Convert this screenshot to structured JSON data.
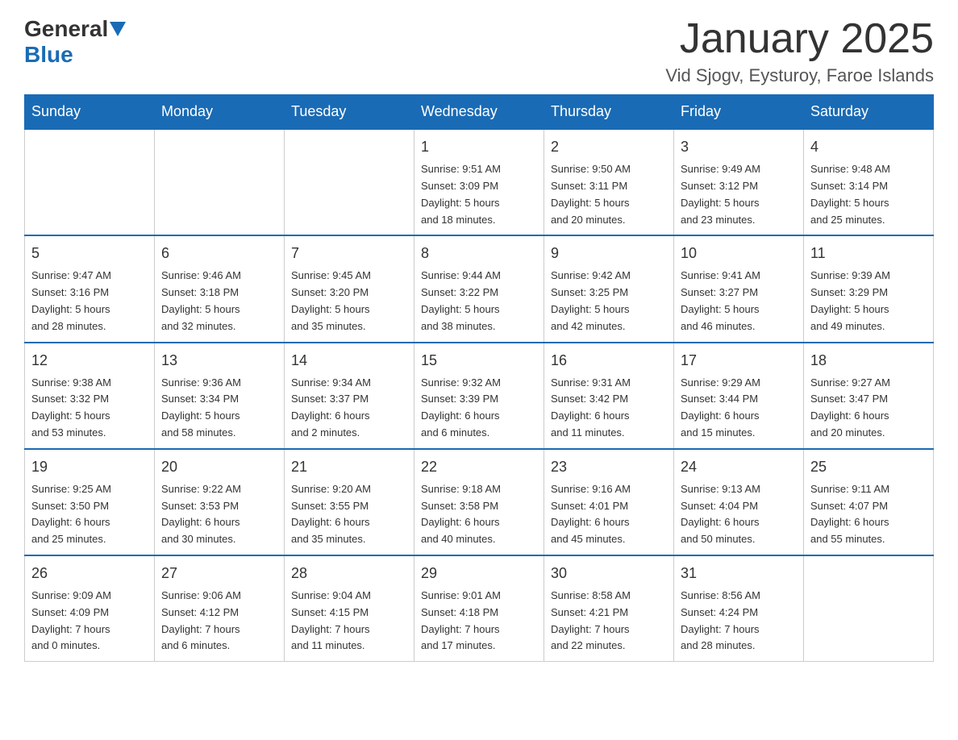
{
  "header": {
    "logo": {
      "general": "General",
      "blue": "Blue"
    },
    "title": "January 2025",
    "location": "Vid Sjogv, Eysturoy, Faroe Islands"
  },
  "calendar": {
    "days_of_week": [
      "Sunday",
      "Monday",
      "Tuesday",
      "Wednesday",
      "Thursday",
      "Friday",
      "Saturday"
    ],
    "weeks": [
      [
        {
          "day": "",
          "info": ""
        },
        {
          "day": "",
          "info": ""
        },
        {
          "day": "",
          "info": ""
        },
        {
          "day": "1",
          "info": "Sunrise: 9:51 AM\nSunset: 3:09 PM\nDaylight: 5 hours\nand 18 minutes."
        },
        {
          "day": "2",
          "info": "Sunrise: 9:50 AM\nSunset: 3:11 PM\nDaylight: 5 hours\nand 20 minutes."
        },
        {
          "day": "3",
          "info": "Sunrise: 9:49 AM\nSunset: 3:12 PM\nDaylight: 5 hours\nand 23 minutes."
        },
        {
          "day": "4",
          "info": "Sunrise: 9:48 AM\nSunset: 3:14 PM\nDaylight: 5 hours\nand 25 minutes."
        }
      ],
      [
        {
          "day": "5",
          "info": "Sunrise: 9:47 AM\nSunset: 3:16 PM\nDaylight: 5 hours\nand 28 minutes."
        },
        {
          "day": "6",
          "info": "Sunrise: 9:46 AM\nSunset: 3:18 PM\nDaylight: 5 hours\nand 32 minutes."
        },
        {
          "day": "7",
          "info": "Sunrise: 9:45 AM\nSunset: 3:20 PM\nDaylight: 5 hours\nand 35 minutes."
        },
        {
          "day": "8",
          "info": "Sunrise: 9:44 AM\nSunset: 3:22 PM\nDaylight: 5 hours\nand 38 minutes."
        },
        {
          "day": "9",
          "info": "Sunrise: 9:42 AM\nSunset: 3:25 PM\nDaylight: 5 hours\nand 42 minutes."
        },
        {
          "day": "10",
          "info": "Sunrise: 9:41 AM\nSunset: 3:27 PM\nDaylight: 5 hours\nand 46 minutes."
        },
        {
          "day": "11",
          "info": "Sunrise: 9:39 AM\nSunset: 3:29 PM\nDaylight: 5 hours\nand 49 minutes."
        }
      ],
      [
        {
          "day": "12",
          "info": "Sunrise: 9:38 AM\nSunset: 3:32 PM\nDaylight: 5 hours\nand 53 minutes."
        },
        {
          "day": "13",
          "info": "Sunrise: 9:36 AM\nSunset: 3:34 PM\nDaylight: 5 hours\nand 58 minutes."
        },
        {
          "day": "14",
          "info": "Sunrise: 9:34 AM\nSunset: 3:37 PM\nDaylight: 6 hours\nand 2 minutes."
        },
        {
          "day": "15",
          "info": "Sunrise: 9:32 AM\nSunset: 3:39 PM\nDaylight: 6 hours\nand 6 minutes."
        },
        {
          "day": "16",
          "info": "Sunrise: 9:31 AM\nSunset: 3:42 PM\nDaylight: 6 hours\nand 11 minutes."
        },
        {
          "day": "17",
          "info": "Sunrise: 9:29 AM\nSunset: 3:44 PM\nDaylight: 6 hours\nand 15 minutes."
        },
        {
          "day": "18",
          "info": "Sunrise: 9:27 AM\nSunset: 3:47 PM\nDaylight: 6 hours\nand 20 minutes."
        }
      ],
      [
        {
          "day": "19",
          "info": "Sunrise: 9:25 AM\nSunset: 3:50 PM\nDaylight: 6 hours\nand 25 minutes."
        },
        {
          "day": "20",
          "info": "Sunrise: 9:22 AM\nSunset: 3:53 PM\nDaylight: 6 hours\nand 30 minutes."
        },
        {
          "day": "21",
          "info": "Sunrise: 9:20 AM\nSunset: 3:55 PM\nDaylight: 6 hours\nand 35 minutes."
        },
        {
          "day": "22",
          "info": "Sunrise: 9:18 AM\nSunset: 3:58 PM\nDaylight: 6 hours\nand 40 minutes."
        },
        {
          "day": "23",
          "info": "Sunrise: 9:16 AM\nSunset: 4:01 PM\nDaylight: 6 hours\nand 45 minutes."
        },
        {
          "day": "24",
          "info": "Sunrise: 9:13 AM\nSunset: 4:04 PM\nDaylight: 6 hours\nand 50 minutes."
        },
        {
          "day": "25",
          "info": "Sunrise: 9:11 AM\nSunset: 4:07 PM\nDaylight: 6 hours\nand 55 minutes."
        }
      ],
      [
        {
          "day": "26",
          "info": "Sunrise: 9:09 AM\nSunset: 4:09 PM\nDaylight: 7 hours\nand 0 minutes."
        },
        {
          "day": "27",
          "info": "Sunrise: 9:06 AM\nSunset: 4:12 PM\nDaylight: 7 hours\nand 6 minutes."
        },
        {
          "day": "28",
          "info": "Sunrise: 9:04 AM\nSunset: 4:15 PM\nDaylight: 7 hours\nand 11 minutes."
        },
        {
          "day": "29",
          "info": "Sunrise: 9:01 AM\nSunset: 4:18 PM\nDaylight: 7 hours\nand 17 minutes."
        },
        {
          "day": "30",
          "info": "Sunrise: 8:58 AM\nSunset: 4:21 PM\nDaylight: 7 hours\nand 22 minutes."
        },
        {
          "day": "31",
          "info": "Sunrise: 8:56 AM\nSunset: 4:24 PM\nDaylight: 7 hours\nand 28 minutes."
        },
        {
          "day": "",
          "info": ""
        }
      ]
    ]
  }
}
